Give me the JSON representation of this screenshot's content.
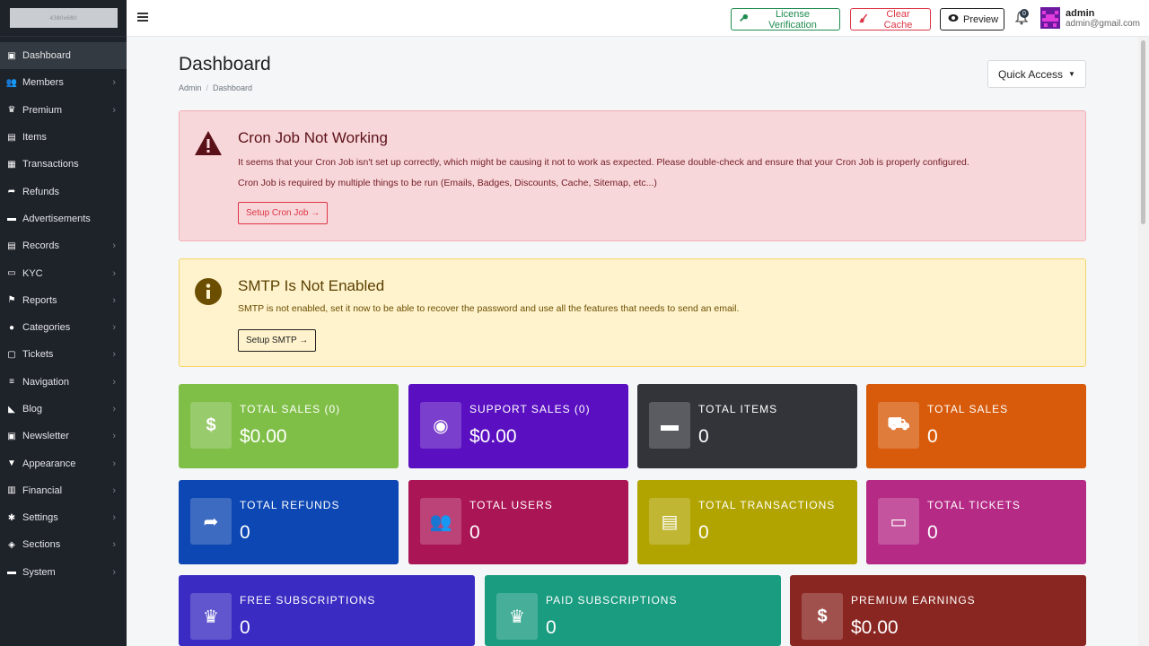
{
  "sidebar": {
    "logo_text": "4380x680",
    "items": [
      {
        "label": "Dashboard",
        "icon": "dashboard-icon",
        "active": true,
        "chevron": false
      },
      {
        "label": "Members",
        "icon": "users-icon",
        "chevron": true
      },
      {
        "label": "Premium",
        "icon": "crown-icon",
        "chevron": true
      },
      {
        "label": "Items",
        "icon": "box-icon",
        "chevron": false
      },
      {
        "label": "Transactions",
        "icon": "receipt-icon",
        "chevron": false
      },
      {
        "label": "Refunds",
        "icon": "share-icon",
        "chevron": false
      },
      {
        "label": "Advertisements",
        "icon": "ad-icon",
        "chevron": false
      },
      {
        "label": "Records",
        "icon": "records-icon",
        "chevron": true
      },
      {
        "label": "KYC",
        "icon": "id-card-icon",
        "chevron": true
      },
      {
        "label": "Reports",
        "icon": "flag-icon",
        "chevron": true
      },
      {
        "label": "Categories",
        "icon": "tag-icon",
        "chevron": true
      },
      {
        "label": "Tickets",
        "icon": "ticket-icon",
        "chevron": true
      },
      {
        "label": "Navigation",
        "icon": "bars-icon",
        "chevron": true
      },
      {
        "label": "Blog",
        "icon": "rss-icon",
        "chevron": true
      },
      {
        "label": "Newsletter",
        "icon": "newsletter-icon",
        "chevron": true
      },
      {
        "label": "Appearance",
        "icon": "brush-icon",
        "chevron": true
      },
      {
        "label": "Financial",
        "icon": "bank-icon",
        "chevron": true
      },
      {
        "label": "Settings",
        "icon": "gear-icon",
        "chevron": true
      },
      {
        "label": "Sections",
        "icon": "layers-icon",
        "chevron": true
      },
      {
        "label": "System",
        "icon": "server-icon",
        "chevron": true
      }
    ]
  },
  "topbar": {
    "license_label": "License Verification",
    "cache_label": "Clear Cache",
    "preview_label": "Preview",
    "notification_count": "0",
    "user_name": "admin",
    "user_email": "admin@gmail.com"
  },
  "page": {
    "title": "Dashboard",
    "breadcrumb": [
      "Admin",
      "Dashboard"
    ],
    "quick_access_label": "Quick Access"
  },
  "alerts": {
    "cron": {
      "title": "Cron Job Not Working",
      "line1": "It seems that your Cron Job isn't set up correctly, which might be causing it not to work as expected. Please double-check and ensure that your Cron Job is properly configured.",
      "line2": "Cron Job is required by multiple things to be run (Emails, Badges, Discounts, Cache, Sitemap, etc...)",
      "button": "Setup Cron Job →"
    },
    "smtp": {
      "title": "SMTP Is Not Enabled",
      "line1": "SMTP is not enabled, set it now to be able to recover the password and use all the features that needs to send an email.",
      "button": "Setup SMTP →"
    }
  },
  "stats": [
    {
      "label": "TOTAL SALES (0)",
      "value": "$0.00",
      "color": "#7fbf47",
      "icon": "dollar-icon"
    },
    {
      "label": "SUPPORT SALES (0)",
      "value": "$0.00",
      "color": "#5a10c1",
      "icon": "money-bag-icon"
    },
    {
      "label": "TOTAL ITEMS",
      "value": "0",
      "color": "#33343a",
      "icon": "box-open-icon"
    },
    {
      "label": "TOTAL SALES",
      "value": "0",
      "color": "#d75b0b",
      "icon": "cart-icon"
    },
    {
      "label": "TOTAL REFUNDS",
      "value": "0",
      "color": "#0d47b3",
      "icon": "share-icon"
    },
    {
      "label": "TOTAL USERS",
      "value": "0",
      "color": "#aa1555",
      "icon": "users-icon"
    },
    {
      "label": "TOTAL TRANSACTIONS",
      "value": "0",
      "color": "#b1a400",
      "icon": "receipt-icon"
    },
    {
      "label": "TOTAL TICKETS",
      "value": "0",
      "color": "#b42a85",
      "icon": "inbox-icon"
    },
    {
      "label": "FREE SUBSCRIPTIONS",
      "value": "0",
      "color": "#3a2cc2",
      "icon": "crown-icon"
    },
    {
      "label": "PAID SUBSCRIPTIONS",
      "value": "0",
      "color": "#1a9c80",
      "icon": "crown-icon"
    },
    {
      "label": "PREMIUM EARNINGS",
      "value": "$0.00",
      "color": "#8a2621",
      "icon": "dollar-icon"
    }
  ]
}
